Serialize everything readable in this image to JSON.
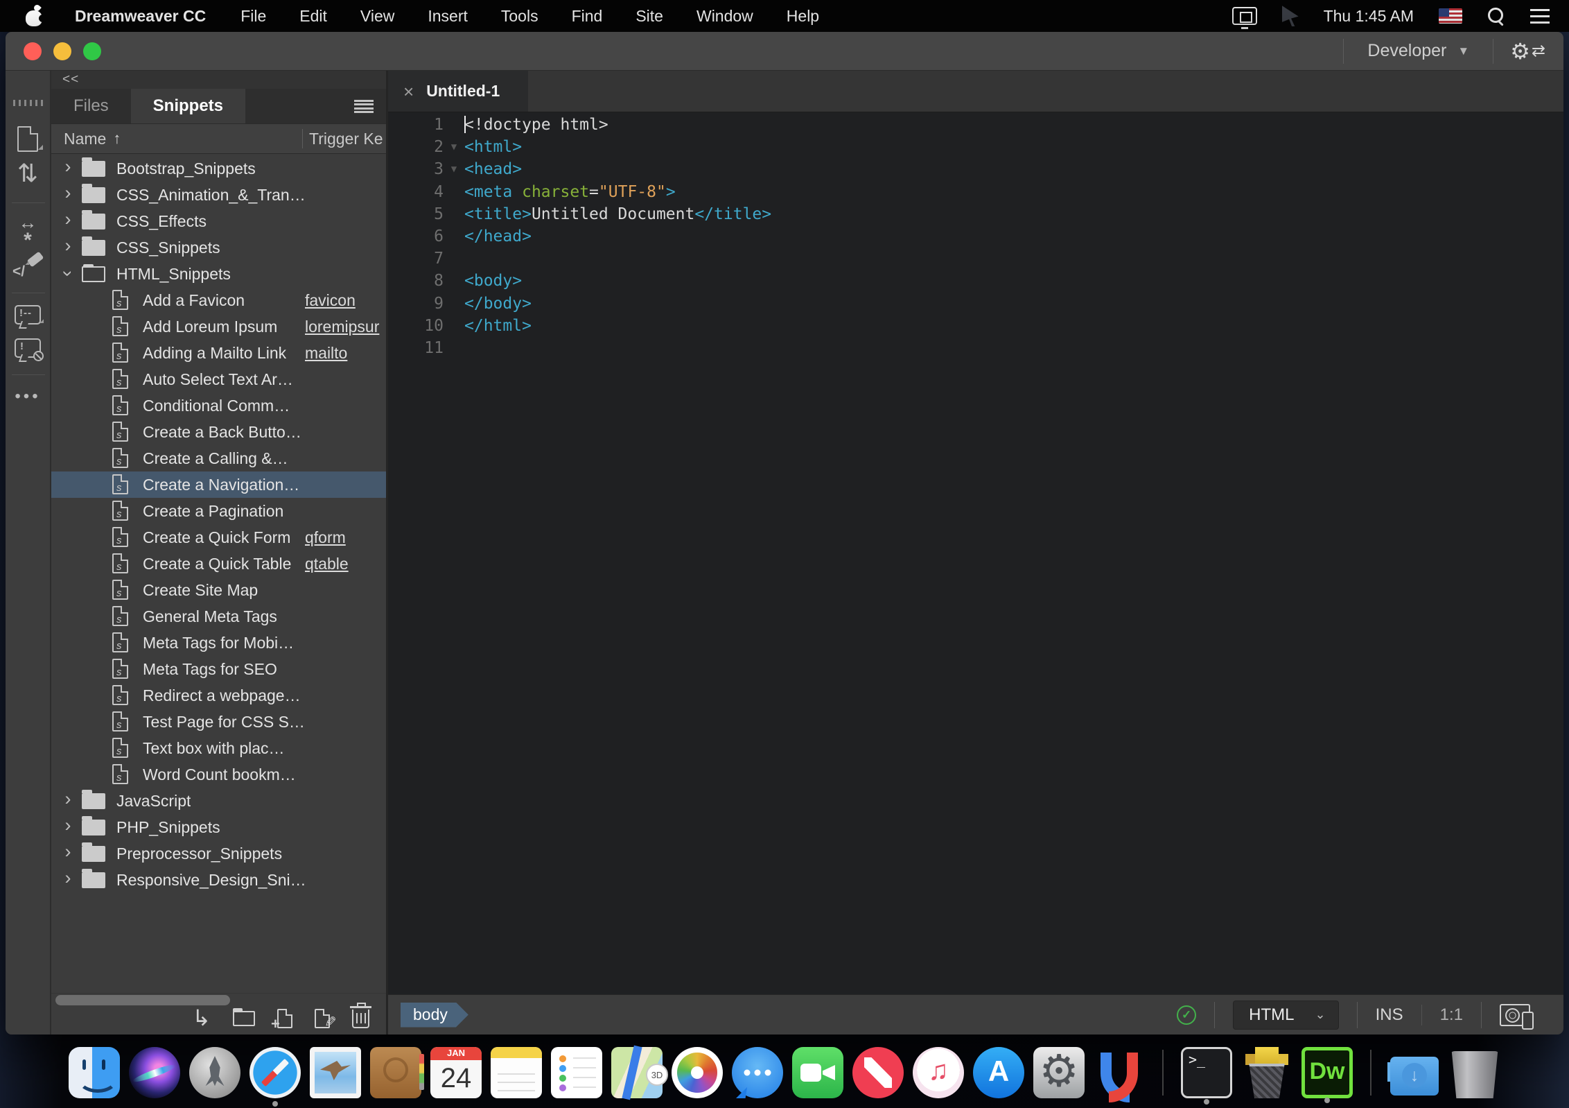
{
  "menubar": {
    "app_name": "Dreamweaver CC",
    "menus": [
      "File",
      "Edit",
      "View",
      "Insert",
      "Tools",
      "Find",
      "Site",
      "Window",
      "Help"
    ],
    "clock": "Thu 1:45 AM",
    "right_icons": [
      "display-mirroring-icon",
      "pointer-icon",
      "input-source-us-flag-icon",
      "spotlight-search-icon",
      "notification-center-icon"
    ]
  },
  "window": {
    "workspace": "Developer",
    "rail_icons": [
      "new-document-icon",
      "file-updown-icon",
      "extend-wrap-icon",
      "code-format-icon",
      "apply-comment-icon",
      "remove-comment-icon",
      "more-options-icon"
    ],
    "panel": {
      "collapse_glyph": "<<",
      "tabs": [
        {
          "label": "Files",
          "active": false
        },
        {
          "label": "Snippets",
          "active": true
        }
      ],
      "columns": {
        "name": "Name",
        "trigger": "Trigger Ke"
      },
      "rows": [
        {
          "type": "folder",
          "label": "Bootstrap_Snippets"
        },
        {
          "type": "folder",
          "label": "CSS_Animation_&_Tran…"
        },
        {
          "type": "folder",
          "label": "CSS_Effects"
        },
        {
          "type": "folder",
          "label": "CSS_Snippets"
        },
        {
          "type": "folder",
          "label": "HTML_Snippets",
          "expanded": true
        },
        {
          "type": "file",
          "label": "Add a Favicon",
          "trigger": "favicon"
        },
        {
          "type": "file",
          "label": "Add Loreum Ipsum",
          "trigger": "loremipsur"
        },
        {
          "type": "file",
          "label": "Adding a Mailto Link",
          "trigger": "mailto"
        },
        {
          "type": "file",
          "label": "Auto Select Text Ar…"
        },
        {
          "type": "file",
          "label": "Conditional Comm…"
        },
        {
          "type": "file",
          "label": "Create a Back Butto…"
        },
        {
          "type": "file",
          "label": "Create a Calling &…"
        },
        {
          "type": "file",
          "label": "Create a Navigation…",
          "selected": true
        },
        {
          "type": "file",
          "label": "Create a Pagination"
        },
        {
          "type": "file",
          "label": "Create a Quick Form",
          "trigger": "qform"
        },
        {
          "type": "file",
          "label": "Create a Quick Table",
          "trigger": "qtable"
        },
        {
          "type": "file",
          "label": "Create Site Map"
        },
        {
          "type": "file",
          "label": "General Meta Tags"
        },
        {
          "type": "file",
          "label": "Meta Tags for Mobi…"
        },
        {
          "type": "file",
          "label": "Meta Tags for SEO"
        },
        {
          "type": "file",
          "label": "Redirect a webpage…"
        },
        {
          "type": "file",
          "label": "Test Page for CSS S…"
        },
        {
          "type": "file",
          "label": "Text box with plac…"
        },
        {
          "type": "file",
          "label": "Word Count bookm…"
        },
        {
          "type": "folder",
          "label": "JavaScript"
        },
        {
          "type": "folder",
          "label": "PHP_Snippets"
        },
        {
          "type": "folder",
          "label": "Preprocessor_Snippets"
        },
        {
          "type": "folder",
          "label": "Responsive_Design_Sni…"
        }
      ],
      "action_icons": [
        "insert-snippet-icon",
        "new-folder-icon",
        "new-snippet-icon",
        "edit-snippet-icon",
        "delete-snippet-icon"
      ]
    },
    "editor": {
      "tab_title": "Untitled-1",
      "lines": [
        {
          "n": 1,
          "cursor": true,
          "tokens": [
            {
              "t": "plain",
              "v": "<!doctype html>"
            }
          ]
        },
        {
          "n": 2,
          "fold": true,
          "tokens": [
            {
              "t": "tag",
              "v": "<html>"
            }
          ]
        },
        {
          "n": 3,
          "fold": true,
          "tokens": [
            {
              "t": "tag",
              "v": "<head>"
            }
          ]
        },
        {
          "n": 4,
          "tokens": [
            {
              "t": "tag",
              "v": "<meta"
            },
            {
              "t": "plain",
              "v": " "
            },
            {
              "t": "attr",
              "v": "charset"
            },
            {
              "t": "plain",
              "v": "="
            },
            {
              "t": "str",
              "v": "\"UTF-8\""
            },
            {
              "t": "tag",
              "v": ">"
            }
          ]
        },
        {
          "n": 5,
          "tokens": [
            {
              "t": "tag",
              "v": "<title>"
            },
            {
              "t": "plain",
              "v": "Untitled Document"
            },
            {
              "t": "tag",
              "v": "</title>"
            }
          ]
        },
        {
          "n": 6,
          "tokens": [
            {
              "t": "tag",
              "v": "</head>"
            }
          ]
        },
        {
          "n": 7,
          "tokens": []
        },
        {
          "n": 8,
          "tokens": [
            {
              "t": "tag",
              "v": "<body>"
            }
          ]
        },
        {
          "n": 9,
          "tokens": [
            {
              "t": "tag",
              "v": "</body>"
            }
          ]
        },
        {
          "n": 10,
          "tokens": [
            {
              "t": "tag",
              "v": "</html>"
            }
          ]
        },
        {
          "n": 11,
          "tokens": []
        }
      ]
    },
    "statusbar": {
      "tag_selector": "body",
      "doc_type": "HTML",
      "insert_mode": "INS",
      "cursor_position": "1:1"
    }
  },
  "dock": {
    "items": [
      {
        "name": "finder",
        "running": true
      },
      {
        "name": "siri"
      },
      {
        "name": "launchpad"
      },
      {
        "name": "safari",
        "running": true
      },
      {
        "name": "mail"
      },
      {
        "name": "contacts"
      },
      {
        "name": "calendar",
        "month": "JAN",
        "day": "24"
      },
      {
        "name": "notes"
      },
      {
        "name": "reminders"
      },
      {
        "name": "maps",
        "badge": "3D"
      },
      {
        "name": "photos"
      },
      {
        "name": "messages"
      },
      {
        "name": "facetime"
      },
      {
        "name": "news"
      },
      {
        "name": "music"
      },
      {
        "name": "app-store"
      },
      {
        "name": "system-preferences"
      },
      {
        "name": "magnet"
      },
      {
        "name": "divider"
      },
      {
        "name": "terminal",
        "label": ">_",
        "running": true
      },
      {
        "name": "stuffit"
      },
      {
        "name": "dreamweaver",
        "label": "Dw",
        "running": true
      },
      {
        "name": "divider"
      },
      {
        "name": "downloads"
      },
      {
        "name": "trash"
      }
    ]
  },
  "colors": {
    "selection": "#45586c",
    "syntax_tag": "#3fa9cc",
    "syntax_attr": "#87b139",
    "syntax_string": "#dfa159",
    "lint_ok_green": "#43b14b",
    "traffic_red": "#ff5f58",
    "traffic_yellow": "#f6be3c",
    "traffic_green": "#30c846",
    "dreamweaver_green": "#71e13e"
  }
}
